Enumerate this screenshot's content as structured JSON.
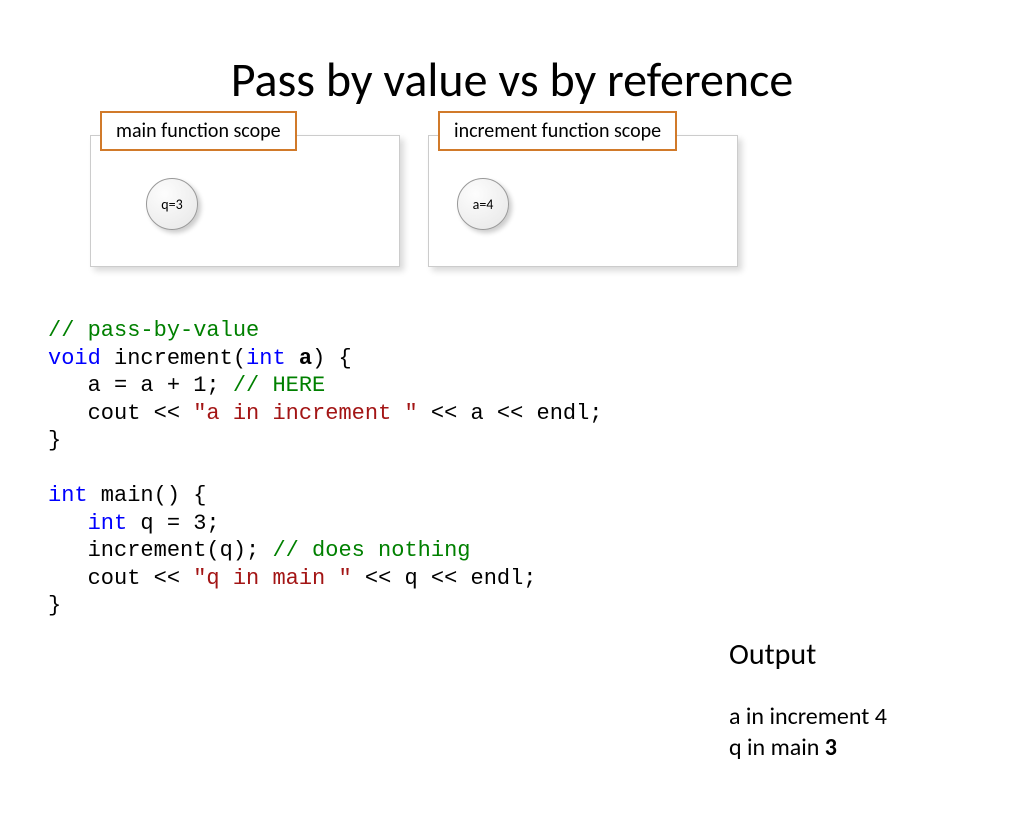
{
  "title": "Pass by value vs by reference",
  "scopes": {
    "main_label": "main function scope",
    "main_var": "q=3",
    "inc_label": "increment function scope",
    "inc_var": "a=4"
  },
  "code": {
    "l1_comment": "// pass-by-value",
    "l2_void": "void",
    "l2_name": " increment(",
    "l2_int": "int",
    "l2_space": " ",
    "l2_a": "a",
    "l2_end": ") {",
    "l3_body": "   a = a + 1; ",
    "l3_comment": "// HERE",
    "l4_a": "   cout << ",
    "l4_str": "\"a in increment \"",
    "l4_b": " << a << endl;",
    "l5": "}",
    "blank": "",
    "l6_int": "int",
    "l6_rest": " main() {",
    "l7_int": "int",
    "l7_rest": " q = 3;",
    "l7_indent": "   ",
    "l8_a": "   increment(q); ",
    "l8_comment": "// does nothing",
    "l9_a": "   cout << ",
    "l9_str": "\"q in main \"",
    "l9_b": " << q << endl;",
    "l10": "}"
  },
  "output": {
    "title": "Output",
    "line1_a": "a in increment 4",
    "line2_a": "q in main ",
    "line2_b": "3"
  }
}
